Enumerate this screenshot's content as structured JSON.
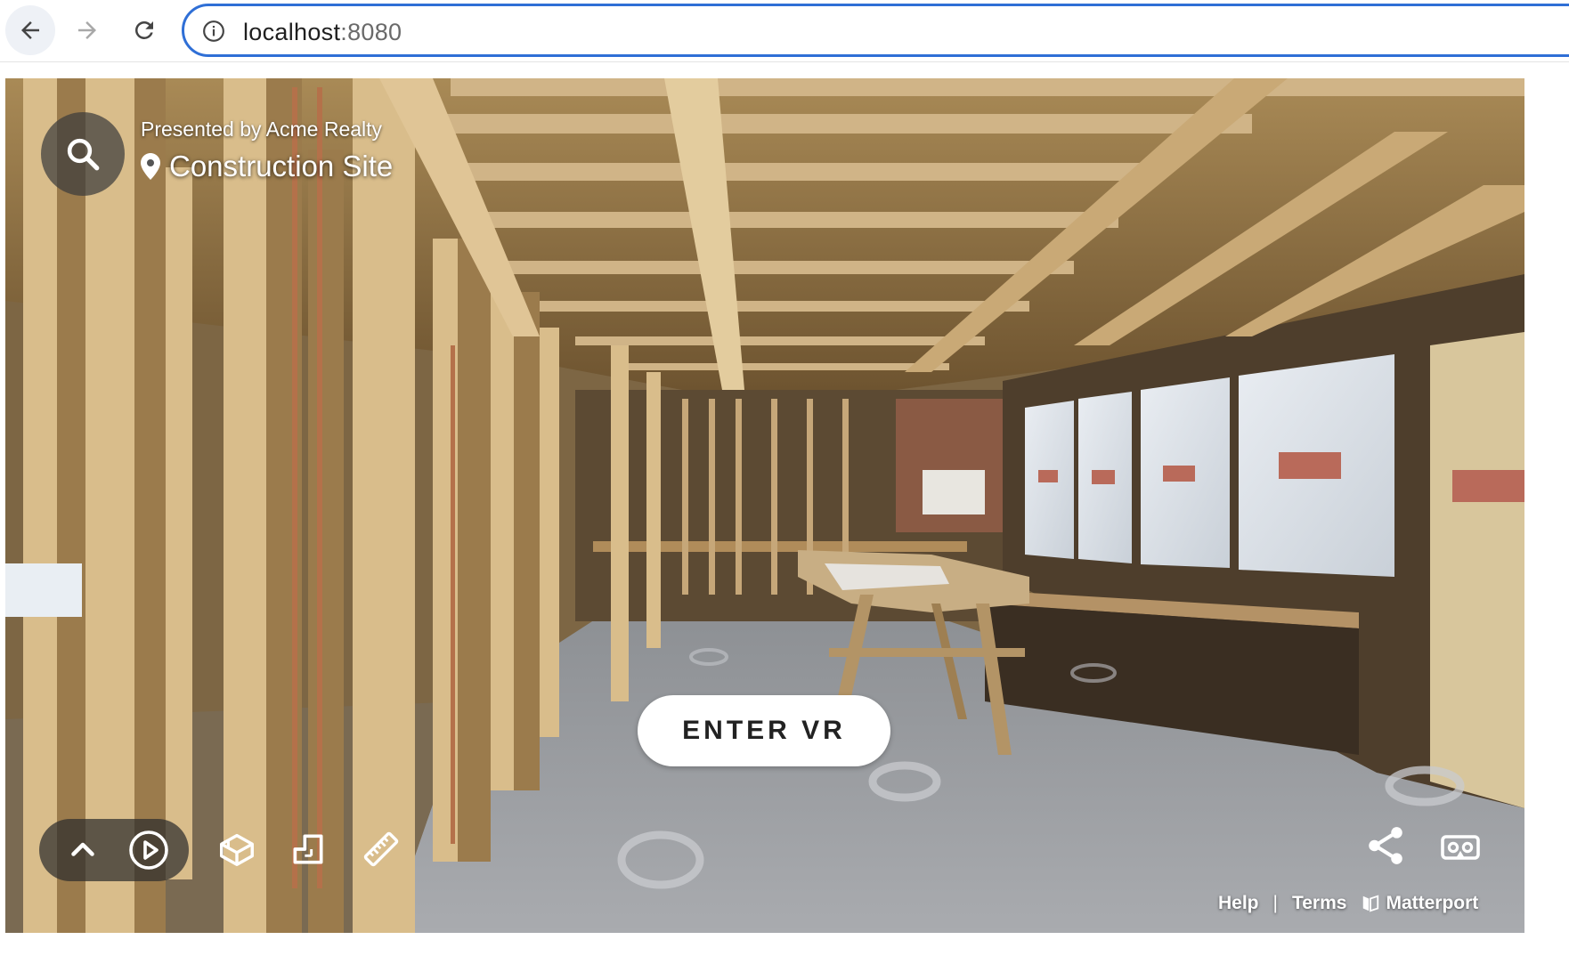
{
  "browser": {
    "url_host": "localhost",
    "url_port": ":8080"
  },
  "viewer": {
    "presented_by": "Presented by Acme Realty",
    "site_name": "Construction Site",
    "vr_button_label": "ENTER VR",
    "footer": {
      "help": "Help",
      "separator": "|",
      "terms": "Terms",
      "brand": "Matterport"
    },
    "icons": [
      "search-icon",
      "location-pin-icon",
      "chevron-up-icon",
      "play-icon",
      "dollhouse-icon",
      "floorplan-icon",
      "measure-icon",
      "share-icon",
      "vr-headset-icon",
      "matterport-logo"
    ]
  }
}
